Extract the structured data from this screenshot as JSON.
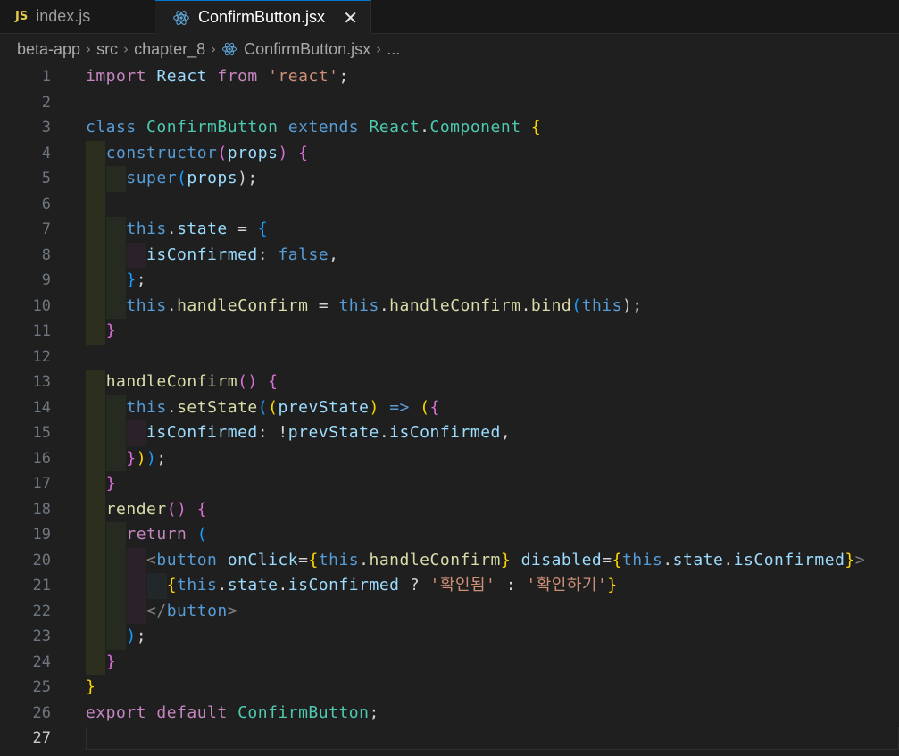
{
  "tabs": [
    {
      "label": "index.js",
      "badge": "JS",
      "icon": "js-icon"
    },
    {
      "label": "ConfirmButton.jsx",
      "icon": "react-icon",
      "close": "✕"
    }
  ],
  "breadcrumb": [
    "beta-app",
    "src",
    "chapter_8",
    "ConfirmButton.jsx",
    "..."
  ],
  "line_numbers": [
    "1",
    "2",
    "3",
    "4",
    "5",
    "6",
    "7",
    "8",
    "9",
    "10",
    "11",
    "12",
    "13",
    "14",
    "15",
    "16",
    "17",
    "18",
    "19",
    "20",
    "21",
    "22",
    "23",
    "24",
    "25",
    "26",
    "27"
  ],
  "colors": {
    "background": "#1f1f1f",
    "keyword": "#569cd6",
    "control": "#c586c0",
    "class": "#4ec9b0",
    "function": "#dcdcaa",
    "variable": "#9cdcfe",
    "string": "#ce9178"
  },
  "code": {
    "l1": [
      "import",
      " ",
      "React",
      " ",
      "from",
      " ",
      "'react'",
      ";"
    ],
    "l3": [
      "class",
      " ",
      "ConfirmButton",
      " ",
      "extends",
      " ",
      "React",
      ".",
      "Component",
      " ",
      "{"
    ],
    "l4": [
      "  ",
      "constructor",
      "(",
      "props",
      ") ",
      "{"
    ],
    "l5": [
      "    ",
      "super",
      "(",
      "props",
      ");"
    ],
    "l7": [
      "    ",
      "this",
      ".",
      "state",
      " = ",
      "{"
    ],
    "l8": [
      "      ",
      "isConfirmed",
      ": ",
      "false",
      ","
    ],
    "l9": [
      "    ",
      "}",
      ";"
    ],
    "l10": [
      "    ",
      "this",
      ".",
      "handleConfirm",
      " = ",
      "this",
      ".",
      "handleConfirm",
      ".",
      "bind",
      "(",
      "this",
      ");"
    ],
    "l11": [
      "  ",
      "}"
    ],
    "l13": [
      "  ",
      "handleConfirm",
      "() ",
      "{"
    ],
    "l14": [
      "    ",
      "this",
      ".",
      "setState",
      "(",
      "(",
      "prevState",
      ") ",
      "=>",
      " ",
      "(",
      "{"
    ],
    "l15": [
      "      ",
      "isConfirmed",
      ": !",
      "prevState",
      ".",
      "isConfirmed",
      ","
    ],
    "l16": [
      "    ",
      "}",
      ")",
      ")",
      ";"
    ],
    "l17": [
      "  ",
      "}"
    ],
    "l18": [
      "  ",
      "render",
      "() ",
      "{"
    ],
    "l19": [
      "    ",
      "return",
      " ",
      "("
    ],
    "l20": [
      "      ",
      "<",
      "button",
      " ",
      "onClick",
      "=",
      "{",
      "this",
      ".",
      "handleConfirm",
      "}",
      " ",
      "disabled",
      "=",
      "{",
      "this",
      ".",
      "state",
      ".",
      "isConfirmed",
      "}",
      ">"
    ],
    "l21": [
      "        ",
      "{",
      "this",
      ".",
      "state",
      ".",
      "isConfirmed",
      " ? ",
      "'확인됨'",
      " : ",
      "'확인하기'",
      "}"
    ],
    "l22": [
      "      ",
      "</",
      "button",
      ">"
    ],
    "l23": [
      "    ",
      ")",
      ";"
    ],
    "l24": [
      "  ",
      "}"
    ],
    "l25": [
      "}"
    ],
    "l26": [
      "export",
      " ",
      "default",
      " ",
      "ConfirmButton",
      ";"
    ]
  }
}
